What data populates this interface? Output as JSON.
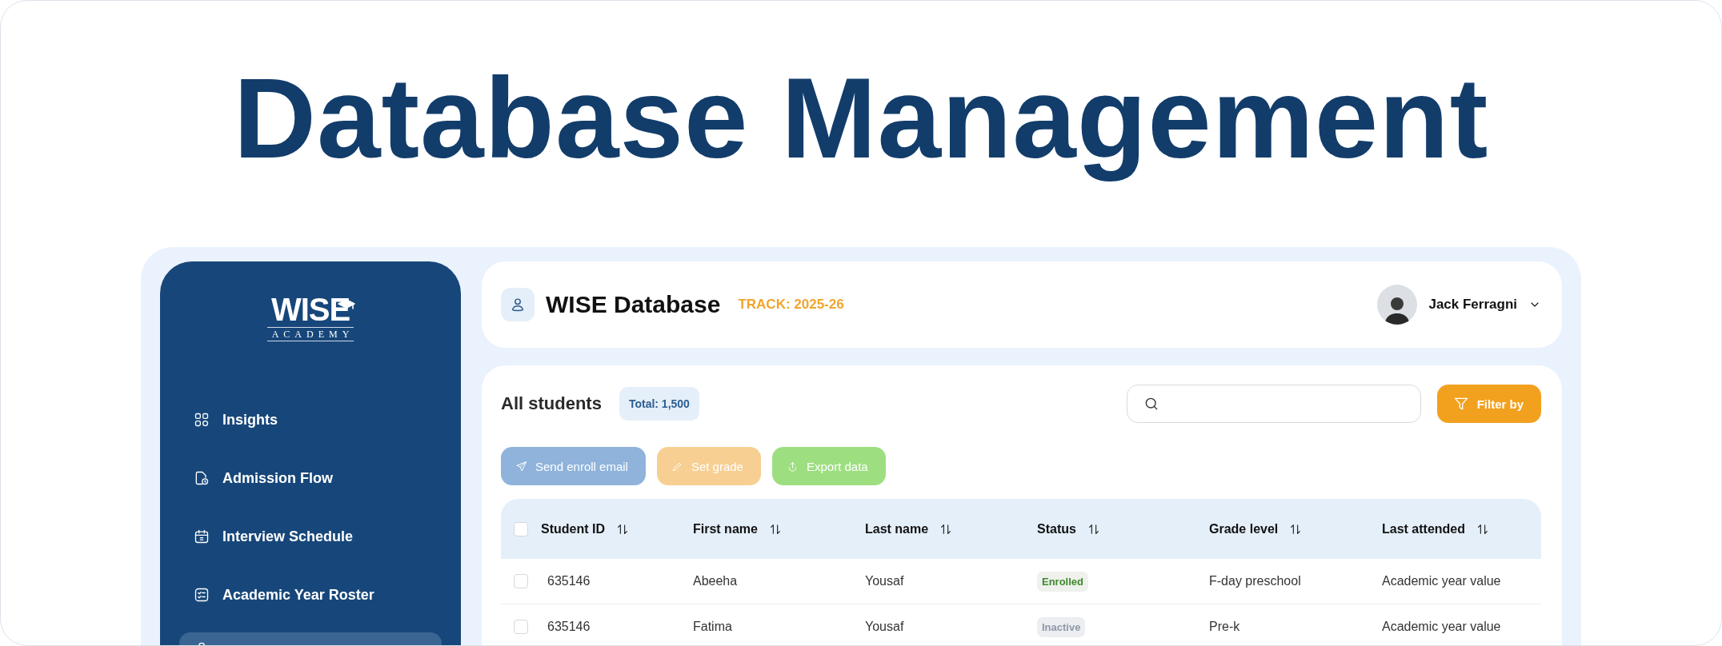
{
  "headline": "Database Management",
  "sidebar": {
    "logo": {
      "word": "WISE",
      "subtitle": "ACADEMY"
    },
    "items": [
      {
        "label": "Insights",
        "kind": "grid",
        "selected": false
      },
      {
        "label": "Admission Flow",
        "kind": "file",
        "selected": false
      },
      {
        "label": "Interview Schedule",
        "kind": "calendar",
        "selected": false
      },
      {
        "label": "Academic Year Roster",
        "kind": "checklist",
        "selected": false
      },
      {
        "kind": "person",
        "selected": true
      }
    ]
  },
  "header": {
    "title": "WISE Database",
    "track": "TRACK: 2025-26",
    "user": {
      "name": "Jack Ferragni"
    }
  },
  "students": {
    "title": "All students",
    "total": "Total: 1,500",
    "filter_button": "Filter by",
    "actions": [
      {
        "label": "Send enroll email",
        "kind": "send"
      },
      {
        "label": "Set grade",
        "kind": "edit"
      },
      {
        "label": "Export data",
        "kind": "export"
      }
    ],
    "table": {
      "all_checked": false,
      "columns": [
        "Student ID",
        "First name",
        "Last name",
        "Status",
        "Grade level",
        "Last attended"
      ],
      "rows": [
        {
          "checked": false,
          "cells": [
            "635146",
            "Abeeha",
            "Yousaf",
            "Enrolled",
            "F-day preschool",
            "Academic year value"
          ],
          "kind": "enrolled"
        },
        {
          "checked": false,
          "cells": [
            "635146",
            "Fatima",
            "Yousaf",
            "Inactive",
            "Pre-k",
            "Academic year value"
          ],
          "kind": "inactive"
        }
      ]
    }
  }
}
